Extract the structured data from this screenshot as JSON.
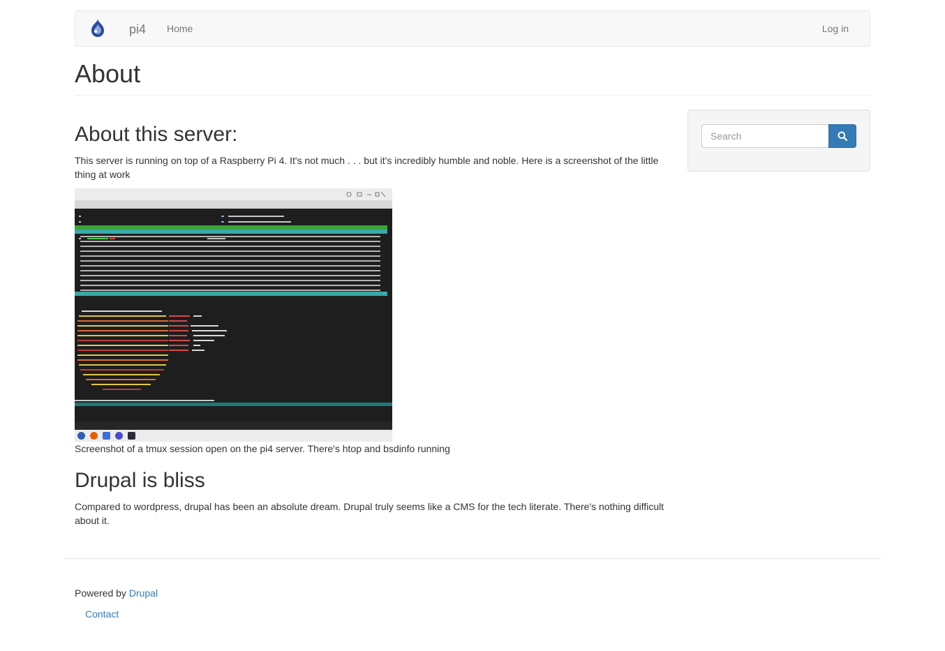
{
  "navbar": {
    "site_name": "pi4",
    "home_label": "Home",
    "login_label": "Log in"
  },
  "page": {
    "title": "About"
  },
  "article": {
    "section1_heading": "About this server:",
    "section1_text": "This server is running on top of a Raspberry Pi 4. It's not much . . . but it's incredibly humble and noble. Here is a screenshot of the little thing at work",
    "image_caption": "Screenshot of a tmux session open on the pi4 server. There's htop and bsdinfo running",
    "section2_heading": "Drupal is bliss",
    "section2_text": "Compared to wordpress, drupal has been an absolute dream. Drupal truly seems like a CMS for the tech literate. There's nothing difficult about it."
  },
  "sidebar": {
    "search_placeholder": "Search"
  },
  "footer": {
    "powered_by": "Powered by",
    "drupal_link": "Drupal",
    "contact_link": "Contact"
  },
  "colors": {
    "link": "#337ab7",
    "nav_text": "#777777",
    "search_button": "#337ab7"
  },
  "icons": {
    "logo": "drupal-drop-icon",
    "search": "search-icon"
  }
}
